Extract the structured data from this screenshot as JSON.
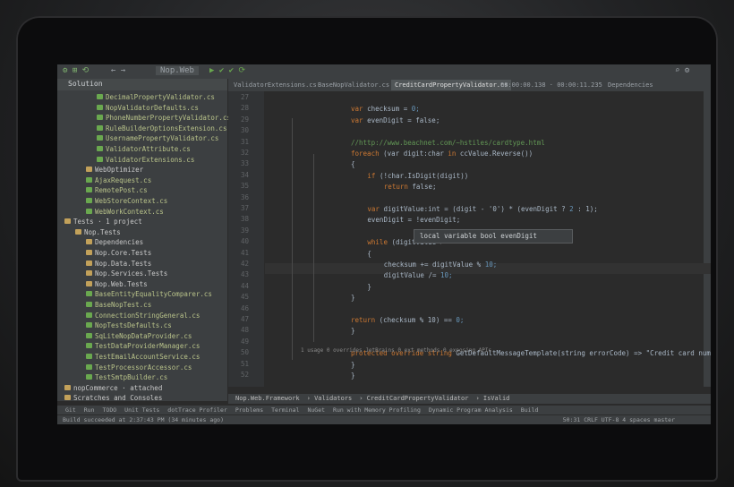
{
  "toolbar": {
    "config": "Nop.Web"
  },
  "project": {
    "title": "Solution",
    "items": [
      {
        "label": "DecimalPropertyValidator.cs",
        "level": 3,
        "dir": false
      },
      {
        "label": "NopValidatorDefaults.cs",
        "level": 3,
        "dir": false
      },
      {
        "label": "PhoneNumberPropertyValidator.cs",
        "level": 3,
        "dir": false
      },
      {
        "label": "RuleBuilderOptionsExtension.cs",
        "level": 3,
        "dir": false
      },
      {
        "label": "UsernamePropertyValidator.cs",
        "level": 3,
        "dir": false
      },
      {
        "label": "ValidatorAttribute.cs",
        "level": 3,
        "dir": false
      },
      {
        "label": "ValidatorExtensions.cs",
        "level": 3,
        "dir": false
      },
      {
        "label": "WebOptimizer",
        "level": 2,
        "dir": true
      },
      {
        "label": "AjaxRequest.cs",
        "level": 2,
        "dir": false
      },
      {
        "label": "RemotePost.cs",
        "level": 2,
        "dir": false
      },
      {
        "label": "WebStoreContext.cs",
        "level": 2,
        "dir": false
      },
      {
        "label": "WebWorkContext.cs",
        "level": 2,
        "dir": false
      },
      {
        "label": "Tests · 1 project",
        "level": 0,
        "dir": true
      },
      {
        "label": "Nop.Tests",
        "level": 1,
        "dir": true
      },
      {
        "label": "Dependencies",
        "level": 2,
        "dir": true
      },
      {
        "label": "Nop.Core.Tests",
        "level": 2,
        "dir": true
      },
      {
        "label": "Nop.Data.Tests",
        "level": 2,
        "dir": true
      },
      {
        "label": "Nop.Services.Tests",
        "level": 2,
        "dir": true
      },
      {
        "label": "Nop.Web.Tests",
        "level": 2,
        "dir": true
      },
      {
        "label": "BaseEntityEqualityComparer.cs",
        "level": 2,
        "dir": false
      },
      {
        "label": "BaseNopTest.cs",
        "level": 2,
        "dir": false
      },
      {
        "label": "ConnectionStringGeneral.cs",
        "level": 2,
        "dir": false
      },
      {
        "label": "NopTestsDefaults.cs",
        "level": 2,
        "dir": false
      },
      {
        "label": "SqLiteNopDataProvider.cs",
        "level": 2,
        "dir": false
      },
      {
        "label": "TestDataProviderManager.cs",
        "level": 2,
        "dir": false
      },
      {
        "label": "TestEmailAccountService.cs",
        "level": 2,
        "dir": false
      },
      {
        "label": "TestProcessorAccessor.cs",
        "level": 2,
        "dir": false
      },
      {
        "label": "TestSmtpBuilder.cs",
        "level": 2,
        "dir": false
      },
      {
        "label": "nopCommerce · attached",
        "level": 0,
        "dir": true
      },
      {
        "label": "Scratches and Consoles",
        "level": 0,
        "dir": true
      }
    ]
  },
  "tabs": [
    "ValidatorExtensions.cs",
    "BaseNopValidator.cs",
    "CreditCardPropertyValidator.cs",
    "00:00:00.138 · 00:00:11.235",
    "Dependencies"
  ],
  "line_numbers": [
    "27",
    "28",
    "29",
    "30",
    "31",
    "32",
    "33",
    "34",
    "35",
    "36",
    "37",
    "38",
    "39",
    "40",
    "41",
    "42",
    "43",
    "44",
    "45",
    "46",
    "47",
    "48",
    "49",
    "50",
    "51",
    "52"
  ],
  "code": [
    {
      "l": 27,
      "t": ""
    },
    {
      "l": 28,
      "t": "var checksum = 0;"
    },
    {
      "l": 29,
      "t": "var evenDigit = false;"
    },
    {
      "l": 30,
      "t": ""
    },
    {
      "l": 31,
      "t": "//http://www.beachnet.com/~hstiles/cardtype.html"
    },
    {
      "l": 32,
      "t": "foreach (var digit:char in ccValue.Reverse())"
    },
    {
      "l": 33,
      "t": "{"
    },
    {
      "l": 34,
      "t": "    if (!char.IsDigit(digit))"
    },
    {
      "l": 35,
      "t": "        return false;"
    },
    {
      "l": 36,
      "t": ""
    },
    {
      "l": 37,
      "t": "    var digitValue:int = (digit - '0') * (evenDigit ? 2 : 1);"
    },
    {
      "l": 38,
      "t": "    evenDigit = !evenDigit;"
    },
    {
      "l": 39,
      "t": ""
    },
    {
      "l": 40,
      "t": "    while (digitValue >"
    },
    {
      "l": 41,
      "t": "    {"
    },
    {
      "l": 42,
      "t": "        checksum += digitValue % 10;"
    },
    {
      "l": 43,
      "t": "        digitValue /= 10;"
    },
    {
      "l": 44,
      "t": "    }"
    },
    {
      "l": 45,
      "t": "}"
    },
    {
      "l": 46,
      "t": ""
    },
    {
      "l": 47,
      "t": "return (checksum % 10) == 0;"
    },
    {
      "l": 48,
      "t": "}"
    },
    {
      "l": 49,
      "t": ""
    },
    {
      "l": 50,
      "t": "protected override string GetDefaultMessageTemplate(string errorCode) => \"Credit card number is"
    },
    {
      "l": 51,
      "t": "}"
    },
    {
      "l": 52,
      "t": "}"
    }
  ],
  "popup": "local variable bool evenDigit",
  "hint": "1 usage   0 overrides   JetBrains   0 ext methods   0 exposing APIs",
  "breadcrumb": [
    "Nop.Web.Framework",
    "Validators",
    "CreditCardPropertyValidator",
    "IsValid"
  ],
  "toolwindows": [
    "Git",
    "Run",
    "TODO",
    "Unit Tests",
    "dotTrace Profiler",
    "Problems",
    "Terminal",
    "NuGet",
    "Run with Memory Profiling",
    "Dynamic Program Analysis",
    "Build"
  ],
  "status": {
    "left": "Build succeeded at 2:37:43 PM (34 minutes ago)",
    "right": "50:31  CRLF  UTF-8  4 spaces  master"
  }
}
